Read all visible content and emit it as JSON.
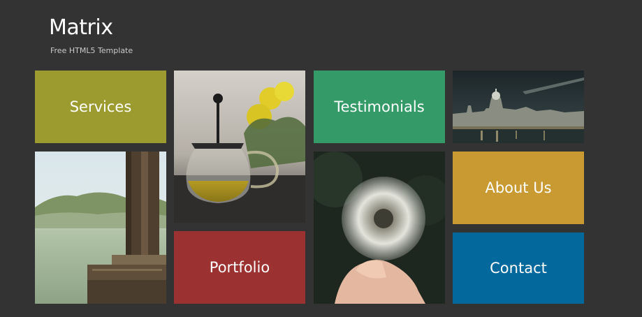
{
  "header": {
    "title": "Matrix",
    "subtitle": "Free HTML5 Template"
  },
  "tiles": {
    "services": {
      "label": "Services",
      "color": "#9b9b30"
    },
    "testimonials": {
      "label": "Testimonials",
      "color": "#349b68"
    },
    "portfolio": {
      "label": "Portfolio",
      "color": "#9b3131"
    },
    "about": {
      "label": "About Us",
      "color": "#c99a31"
    },
    "contact": {
      "label": "Contact",
      "color": "#03689b"
    }
  },
  "photos": [
    "french-press-tea",
    "city-night-skyline",
    "lake-dock-misty",
    "dandelion-in-hand"
  ]
}
